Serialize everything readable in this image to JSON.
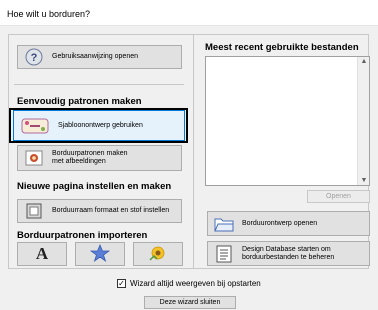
{
  "window": {
    "title": "Hoe wilt u borduren?"
  },
  "left": {
    "help_button": "Gebruiksaanwijzing openen",
    "section_easy": "Eenvoudig patronen maken",
    "template_button": "Sjabloonontwerp gebruiken",
    "picture_button": "Borduurpatronen maken\nmet afbeeldingen",
    "section_newpage": "Nieuwe pagina instellen en maken",
    "hoop_button": "Borduurraam formaat en stof instellen",
    "section_import": "Borduurpatronen importeren"
  },
  "right": {
    "recent_title": "Meest recent gebruikte bestanden",
    "open_button": "Openen",
    "open_design_button": "Borduurontwerp openen",
    "design_db_button": "Design Database starten om\nborduurbestanden te beheren"
  },
  "footer": {
    "show_at_startup": "Wizard altijd weergeven bij opstarten",
    "close_button": "Deze wizard sluiten"
  },
  "icons": {
    "help": "help-icon",
    "template": "template-icon",
    "picture": "picture-icon",
    "hoop": "hoop-icon",
    "text": "text-icon",
    "shape": "star-shape-icon",
    "image": "image-import-icon",
    "open_folder": "open-folder-icon",
    "database": "database-icon"
  }
}
